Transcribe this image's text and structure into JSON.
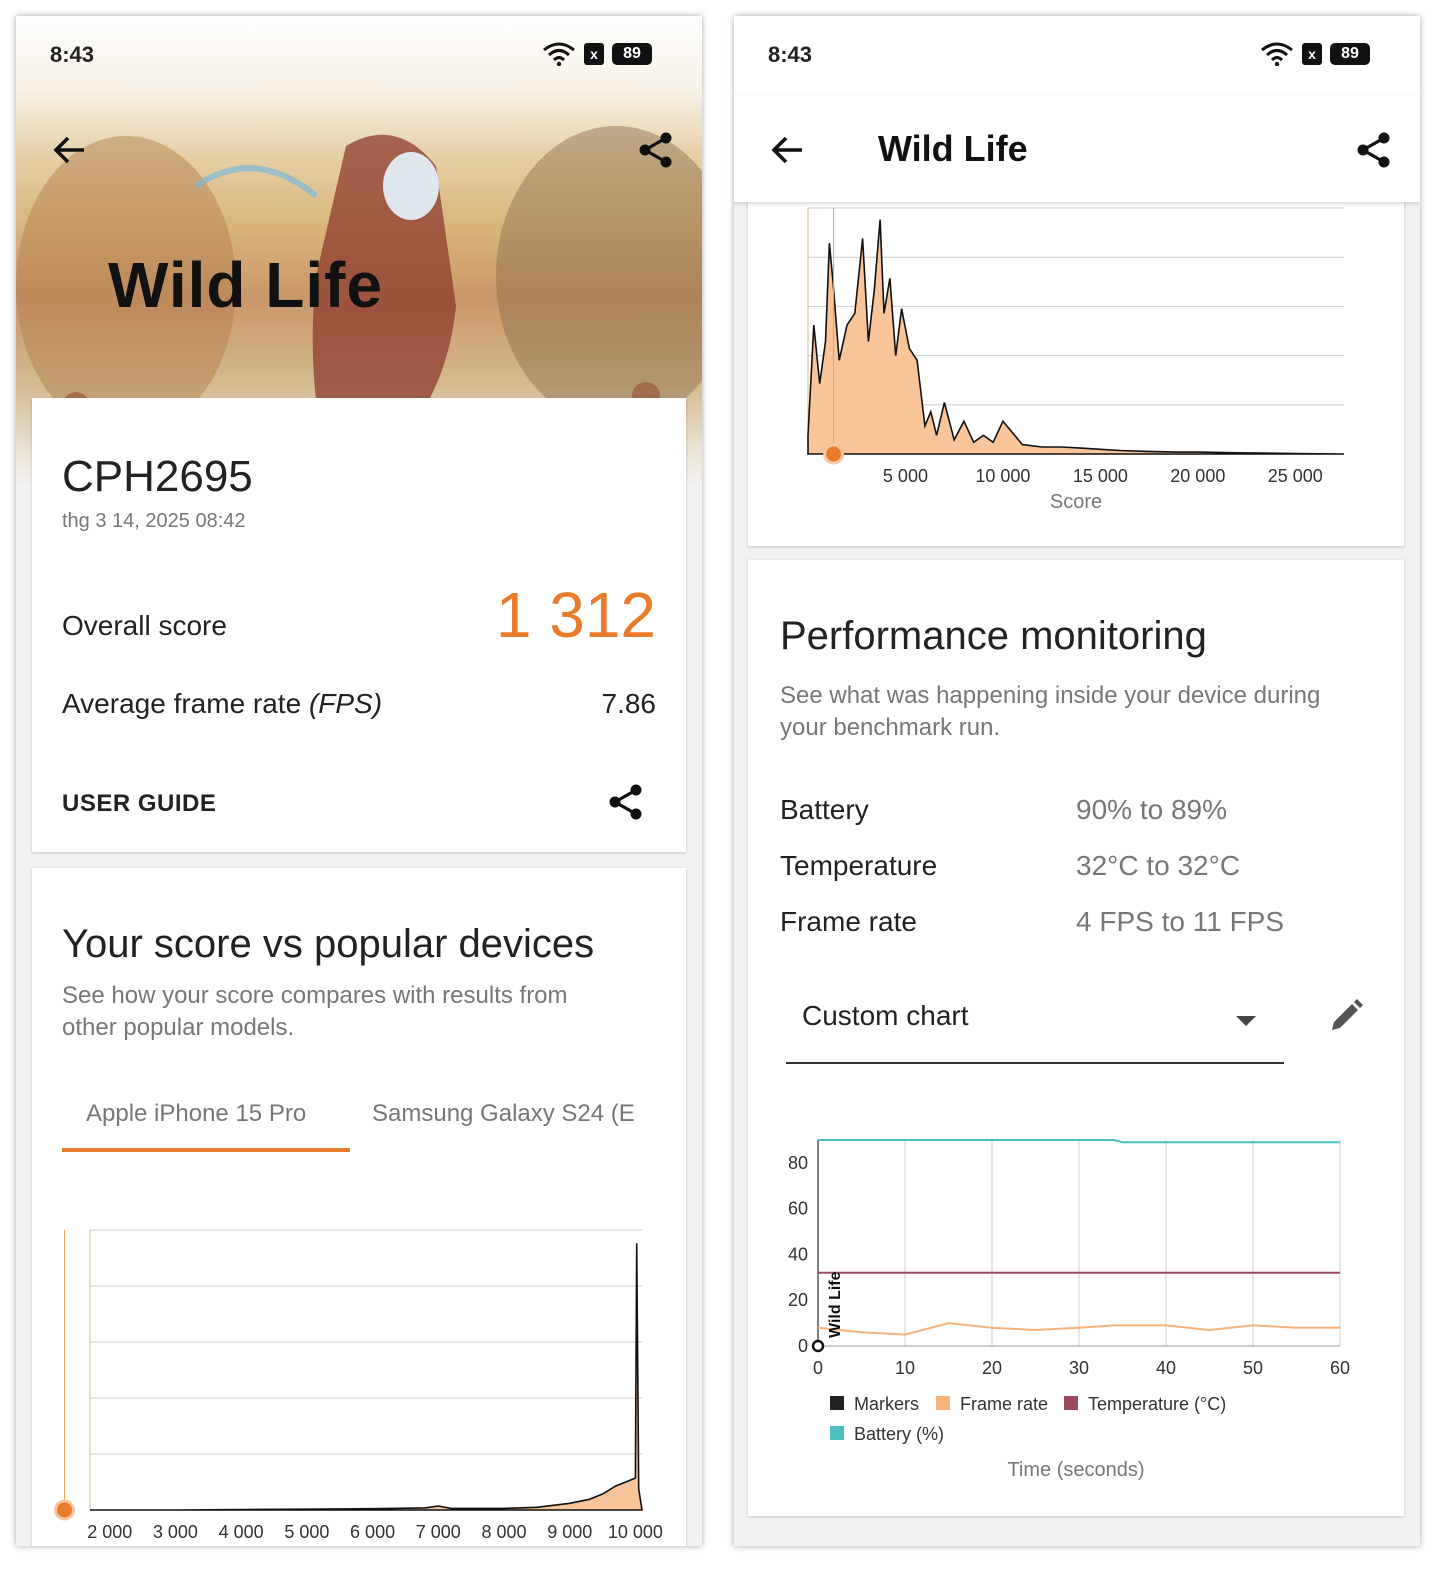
{
  "status": {
    "time": "8:43",
    "battery": "89",
    "sim_badge": "x"
  },
  "left": {
    "hero_title": "Wild Life",
    "device": "CPH2695",
    "date": "thg 3 14, 2025 08:42",
    "overall_label": "Overall score",
    "overall_value": "1 312",
    "fps_label_prefix": "Average frame rate ",
    "fps_label_italic": "(FPS)",
    "fps_value": "7.86",
    "user_guide": "USER GUIDE",
    "compare_title": "Your score vs popular devices",
    "compare_sub_1": "See how your score compares with results from",
    "compare_sub_2": "other popular models.",
    "tabs": [
      "Apple iPhone 15 Pro",
      "Samsung Galaxy S24 (E"
    ],
    "accent": "#e97b2a"
  },
  "right": {
    "title": "Wild Life",
    "perf_title": "Performance monitoring",
    "perf_sub_1": "See what was happening inside your device during",
    "perf_sub_2": "your benchmark run.",
    "rows": [
      {
        "label": "Battery",
        "value": "90% to 89%"
      },
      {
        "label": "Temperature",
        "value": "32°C to 32°C"
      },
      {
        "label": "Frame rate",
        "value": "4 FPS to 11 FPS"
      }
    ],
    "chart_select": "Custom chart"
  },
  "chart_data": [
    {
      "type": "area",
      "title": "",
      "xlabel": "Score",
      "ylabel": "",
      "x_ticks": [
        "2 000",
        "3 000",
        "4 000",
        "5 000",
        "6 000",
        "7 000",
        "8 000",
        "9 000",
        "10 000"
      ],
      "xlim": [
        1700,
        10100
      ],
      "grid": true,
      "marker_score": 1312,
      "series": [
        {
          "values_x": [
            1700,
            3000,
            4000,
            5000,
            6000,
            6800,
            7000,
            7200,
            8000,
            8500,
            9000,
            9300,
            9500,
            9700,
            9900,
            10000,
            10020,
            10050,
            10100
          ],
          "values_y": [
            0,
            0,
            0.2,
            0.3,
            0.5,
            0.8,
            1.5,
            0.6,
            0.6,
            1.0,
            2.5,
            4,
            6,
            9,
            11,
            12,
            100,
            8,
            0
          ]
        }
      ],
      "fill_color": "#f8c49a"
    },
    {
      "type": "area",
      "title": "",
      "xlabel": "Score",
      "ylabel": "",
      "x_ticks": [
        "5 000",
        "10 000",
        "15 000",
        "20 000",
        "25 000"
      ],
      "xlim": [
        0,
        27500
      ],
      "grid": true,
      "marker_score": 1312,
      "series": [
        {
          "values_x": [
            0,
            300,
            600,
            900,
            1100,
            1300,
            1600,
            2000,
            2400,
            2800,
            3100,
            3400,
            3700,
            3900,
            4200,
            4500,
            4800,
            5200,
            5600,
            6000,
            6300,
            6600,
            7000,
            7500,
            8000,
            8500,
            9000,
            9500,
            10000,
            11000,
            12000,
            13000,
            14000,
            15000,
            16000,
            17000,
            18000,
            19000,
            20000,
            22000,
            25000,
            27500
          ],
          "values_y": [
            8,
            55,
            30,
            48,
            90,
            72,
            40,
            55,
            60,
            92,
            48,
            70,
            100,
            60,
            75,
            42,
            62,
            45,
            40,
            12,
            18,
            8,
            22,
            6,
            14,
            5,
            8,
            5,
            14,
            4,
            3,
            3,
            2.5,
            2,
            1.5,
            1.2,
            1,
            0.8,
            0.8,
            0.5,
            0.2,
            0
          ]
        }
      ],
      "fill_color": "#f8c49a"
    },
    {
      "type": "line",
      "title": "",
      "xlabel": "Time (seconds)",
      "ylabel": "",
      "x": [
        0,
        5,
        10,
        15,
        20,
        25,
        30,
        34,
        35,
        40,
        45,
        50,
        55,
        60
      ],
      "xlim": [
        0,
        60
      ],
      "ylim": [
        0,
        90
      ],
      "y_ticks": [
        "0",
        "20",
        "40",
        "60",
        "80"
      ],
      "x_ticks": [
        "0",
        "10",
        "20",
        "30",
        "40",
        "50",
        "60"
      ],
      "marker_label": "Wild Life",
      "series": [
        {
          "name": "Markers",
          "color": "#222222",
          "values": []
        },
        {
          "name": "Frame rate",
          "color": "#f8b27a",
          "values": [
            8,
            6,
            5,
            10,
            8,
            7,
            8,
            9,
            9,
            9,
            7,
            9,
            8,
            8
          ]
        },
        {
          "name": "Temperature (°C)",
          "color": "#9c4a5f",
          "values": [
            32,
            32,
            32,
            32,
            32,
            32,
            32,
            32,
            32,
            32,
            32,
            32,
            32,
            32
          ]
        },
        {
          "name": "Battery (%)",
          "color": "#4dbfbf",
          "values": [
            90,
            90,
            90,
            90,
            90,
            90,
            90,
            90,
            89,
            89,
            89,
            89,
            89,
            89
          ]
        }
      ]
    }
  ]
}
